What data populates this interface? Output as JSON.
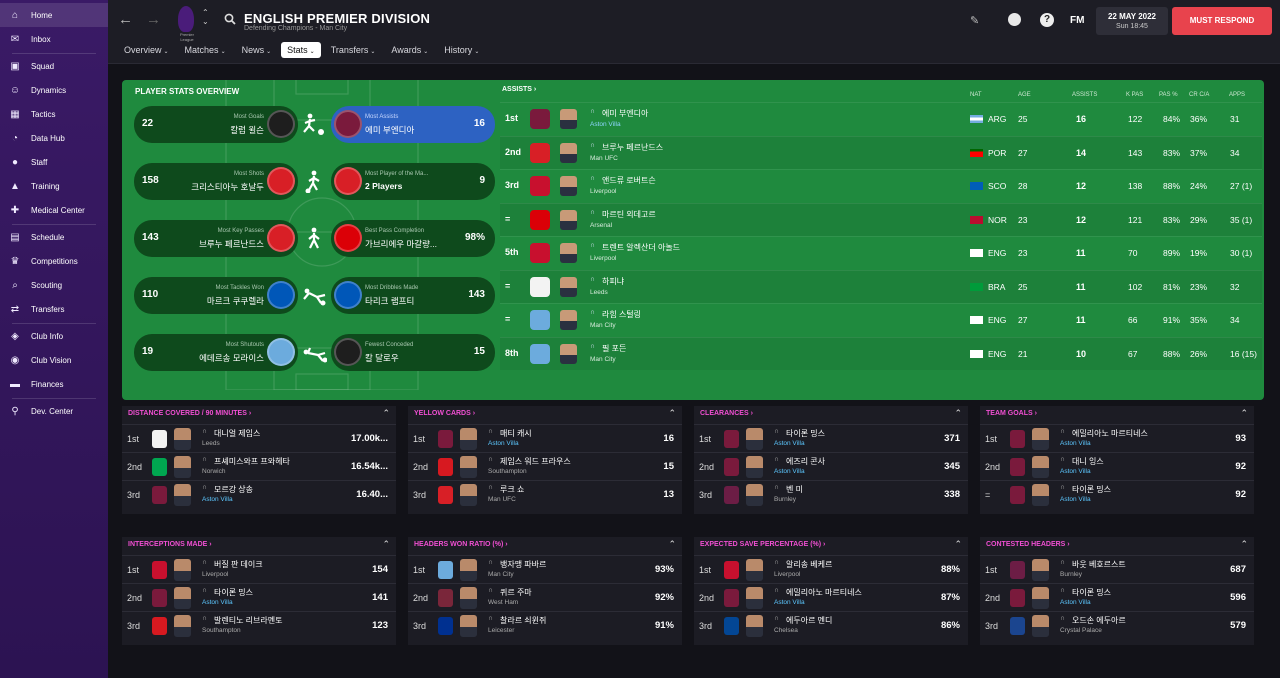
{
  "sidebar": {
    "items": [
      {
        "label": "Home",
        "icon": "home-icon",
        "glyph": "⌂"
      },
      {
        "label": "Inbox",
        "icon": "inbox-icon",
        "glyph": "✉"
      },
      {
        "label": "Squad",
        "icon": "shirt-icon",
        "glyph": "▣"
      },
      {
        "label": "Dynamics",
        "icon": "dynamics-icon",
        "glyph": "☺"
      },
      {
        "label": "Tactics",
        "icon": "tactics-icon",
        "glyph": "▦"
      },
      {
        "label": "Data Hub",
        "icon": "data-hub-icon",
        "glyph": "◔"
      },
      {
        "label": "Staff",
        "icon": "staff-icon",
        "glyph": "●"
      },
      {
        "label": "Training",
        "icon": "training-icon",
        "glyph": "▲"
      },
      {
        "label": "Medical Center",
        "icon": "medical-icon",
        "glyph": "✚"
      },
      {
        "label": "Schedule",
        "icon": "calendar-icon",
        "glyph": "▤"
      },
      {
        "label": "Competitions",
        "icon": "trophy-icon",
        "glyph": "♛"
      },
      {
        "label": "Scouting",
        "icon": "scouting-icon",
        "glyph": "⌕"
      },
      {
        "label": "Transfers",
        "icon": "transfers-icon",
        "glyph": "⇄"
      },
      {
        "label": "Club Info",
        "icon": "shield-icon",
        "glyph": "◈"
      },
      {
        "label": "Club Vision",
        "icon": "vision-icon",
        "glyph": "◉"
      },
      {
        "label": "Finances",
        "icon": "finances-icon",
        "glyph": "▬"
      },
      {
        "label": "Dev. Center",
        "icon": "dev-center-icon",
        "glyph": "⚲"
      }
    ]
  },
  "topbar": {
    "league_mini": "Premier League",
    "title": "ENGLISH PREMIER DIVISION",
    "subtitle": "Defending Champions - Man City",
    "tabs": [
      {
        "label": "Overview",
        "active": false
      },
      {
        "label": "Matches",
        "active": false
      },
      {
        "label": "News",
        "active": false
      },
      {
        "label": "Stats",
        "active": true
      },
      {
        "label": "Transfers",
        "active": false
      },
      {
        "label": "Awards",
        "active": false
      },
      {
        "label": "History",
        "active": false
      }
    ],
    "date": "22 MAY 2022",
    "time": "Sun 18:45",
    "fm_label": "FM",
    "must_respond": "MUST RESPOND",
    "help": "?"
  },
  "overview": {
    "title": "PLAYER STATS OVERVIEW",
    "pairs": [
      {
        "left": {
          "category": "Most Goals",
          "name": "칼럼 윌슨",
          "value": "22",
          "crest": "newcastle"
        },
        "right": {
          "category": "Most Assists",
          "name": "에미 부엔디아",
          "value": "16",
          "crest": "villa",
          "highlight": true
        }
      },
      {
        "left": {
          "category": "Most Shots",
          "name": "크리스티아누 호날두",
          "value": "158",
          "crest": "manutd"
        },
        "right": {
          "category": "Most Player of the Ma...",
          "name": "2 Players",
          "value": "9",
          "crest": "manutd",
          "bold": true
        }
      },
      {
        "left": {
          "category": "Most Key Passes",
          "name": "브루누 페르난드스",
          "value": "143",
          "crest": "manutd"
        },
        "right": {
          "category": "Best Pass Completion",
          "name": "가브리에우 마갈량...",
          "value": "98%",
          "crest": "arsenal"
        }
      },
      {
        "left": {
          "category": "Most Tackles Won",
          "name": "마르크 쿠쿠렐라",
          "value": "110",
          "crest": "brighton"
        },
        "right": {
          "category": "Most Dribbles Made",
          "name": "타리크 램프티",
          "value": "143",
          "crest": "brighton"
        }
      },
      {
        "left": {
          "category": "Most Shutouts",
          "name": "에데르송 모라이스",
          "value": "19",
          "crest": "mancity"
        },
        "right": {
          "category": "Fewest Conceded",
          "name": "칼 달로우",
          "value": "15",
          "crest": "newcastle"
        }
      }
    ]
  },
  "assists": {
    "title": "ASSISTS",
    "columns": {
      "nat": "NAT",
      "age": "AGE",
      "assists": "ASSISTS",
      "kpas": "K PAS",
      "pas": "PAS %",
      "crca": "CR C/A",
      "apps": "APPS"
    },
    "rows": [
      {
        "rank": "1st",
        "name": "에미 부엔디아",
        "club": "Aston Villa",
        "club_hl": true,
        "crest": "villa",
        "flag": "arg",
        "nat": "ARG",
        "age": "25",
        "assists": "16",
        "kpas": "122",
        "pas": "84%",
        "crca": "36%",
        "apps": "31"
      },
      {
        "rank": "2nd",
        "name": "브루누 페르난드스",
        "club": "Man UFC",
        "club_hl": false,
        "crest": "manutd",
        "flag": "por",
        "nat": "POR",
        "age": "27",
        "assists": "14",
        "kpas": "143",
        "pas": "83%",
        "crca": "37%",
        "apps": "34"
      },
      {
        "rank": "3rd",
        "name": "앤드류 로버트슨",
        "club": "Liverpool",
        "club_hl": false,
        "crest": "liverpool",
        "flag": "sco",
        "nat": "SCO",
        "age": "28",
        "assists": "12",
        "kpas": "138",
        "pas": "88%",
        "crca": "24%",
        "apps": "27 (1)"
      },
      {
        "rank": "=",
        "name": "마르틴 외데고르",
        "club": "Arsenal",
        "club_hl": false,
        "crest": "arsenal",
        "flag": "nor",
        "nat": "NOR",
        "age": "23",
        "assists": "12",
        "kpas": "121",
        "pas": "83%",
        "crca": "29%",
        "apps": "35 (1)"
      },
      {
        "rank": "5th",
        "name": "트렌트 알렉산더 아놀드",
        "club": "Liverpool",
        "club_hl": false,
        "crest": "liverpool",
        "flag": "eng",
        "nat": "ENG",
        "age": "23",
        "assists": "11",
        "kpas": "70",
        "pas": "89%",
        "crca": "19%",
        "apps": "30 (1)"
      },
      {
        "rank": "=",
        "name": "하피냐",
        "club": "Leeds",
        "club_hl": false,
        "crest": "leeds",
        "flag": "bra",
        "nat": "BRA",
        "age": "25",
        "assists": "11",
        "kpas": "102",
        "pas": "81%",
        "crca": "23%",
        "apps": "32"
      },
      {
        "rank": "=",
        "name": "라힘 스털링",
        "club": "Man City",
        "club_hl": false,
        "crest": "mancity",
        "flag": "eng",
        "nat": "ENG",
        "age": "27",
        "assists": "11",
        "kpas": "66",
        "pas": "91%",
        "crca": "35%",
        "apps": "34"
      },
      {
        "rank": "8th",
        "name": "필 포든",
        "club": "Man City",
        "club_hl": false,
        "crest": "mancity",
        "flag": "eng",
        "nat": "ENG",
        "age": "21",
        "assists": "10",
        "kpas": "67",
        "pas": "88%",
        "crca": "26%",
        "apps": "16 (15)"
      }
    ]
  },
  "cards": [
    {
      "title": "DISTANCE COVERED / 90 MINUTES",
      "rows": [
        {
          "rank": "1st",
          "name": "대니얼 제임스",
          "club": "Leeds",
          "club_hl": false,
          "crest": "leeds",
          "value": "17.00k..."
        },
        {
          "rank": "2nd",
          "name": "프셰미스와프 프와헤타",
          "club": "Norwich",
          "club_hl": false,
          "crest": "norwich",
          "value": "16.54k..."
        },
        {
          "rank": "3rd",
          "name": "모르강 상송",
          "club": "Aston Villa",
          "club_hl": true,
          "crest": "villa",
          "value": "16.40..."
        }
      ]
    },
    {
      "title": "YELLOW CARDS",
      "rows": [
        {
          "rank": "1st",
          "name": "매티 캐시",
          "club": "Aston Villa",
          "club_hl": true,
          "crest": "villa",
          "value": "16"
        },
        {
          "rank": "2nd",
          "name": "제임스 워드 프라우스",
          "club": "Southampton",
          "club_hl": false,
          "crest": "southampton",
          "value": "15"
        },
        {
          "rank": "3rd",
          "name": "루크 쇼",
          "club": "Man UFC",
          "club_hl": false,
          "crest": "manutd",
          "value": "13"
        }
      ]
    },
    {
      "title": "CLEARANCES",
      "rows": [
        {
          "rank": "1st",
          "name": "타이론 밍스",
          "club": "Aston Villa",
          "club_hl": true,
          "crest": "villa",
          "value": "371"
        },
        {
          "rank": "2nd",
          "name": "에즈리 콘사",
          "club": "Aston Villa",
          "club_hl": true,
          "crest": "villa",
          "value": "345"
        },
        {
          "rank": "3rd",
          "name": "벤 미",
          "club": "Burnley",
          "club_hl": false,
          "crest": "burnley",
          "value": "338"
        }
      ]
    },
    {
      "title": "TEAM GOALS",
      "rows": [
        {
          "rank": "1st",
          "name": "에밀리아노 마르티네스",
          "club": "Aston Villa",
          "club_hl": true,
          "crest": "villa",
          "value": "93"
        },
        {
          "rank": "2nd",
          "name": "대니 잉스",
          "club": "Aston Villa",
          "club_hl": true,
          "crest": "villa",
          "value": "92"
        },
        {
          "rank": "=",
          "name": "타이론 밍스",
          "club": "Aston Villa",
          "club_hl": true,
          "crest": "villa",
          "value": "92"
        }
      ]
    },
    {
      "title": "INTERCEPTIONS MADE",
      "rows": [
        {
          "rank": "1st",
          "name": "버질 판 데이크",
          "club": "Liverpool",
          "club_hl": false,
          "crest": "liverpool",
          "value": "154"
        },
        {
          "rank": "2nd",
          "name": "타이론 밍스",
          "club": "Aston Villa",
          "club_hl": true,
          "crest": "villa",
          "value": "141"
        },
        {
          "rank": "3rd",
          "name": "발렌티노 리브라멘토",
          "club": "Southampton",
          "club_hl": false,
          "crest": "southampton",
          "value": "123"
        }
      ]
    },
    {
      "title": "HEADERS WON RATIO (%)",
      "rows": [
        {
          "rank": "1st",
          "name": "뱅자맹 파바르",
          "club": "Man City",
          "club_hl": false,
          "crest": "mancity",
          "value": "93%"
        },
        {
          "rank": "2nd",
          "name": "퀴르 주마",
          "club": "West Ham",
          "club_hl": false,
          "crest": "westham",
          "value": "92%"
        },
        {
          "rank": "3rd",
          "name": "찰라르 쇠윈쥐",
          "club": "Leicester",
          "club_hl": false,
          "crest": "leicester",
          "value": "91%"
        }
      ]
    },
    {
      "title": "EXPECTED SAVE PERCENTAGE (%)",
      "rows": [
        {
          "rank": "1st",
          "name": "알리송 베케르",
          "club": "Liverpool",
          "club_hl": false,
          "crest": "liverpool",
          "value": "88%"
        },
        {
          "rank": "2nd",
          "name": "에밀리아노 마르티네스",
          "club": "Aston Villa",
          "club_hl": true,
          "crest": "villa",
          "value": "87%"
        },
        {
          "rank": "3rd",
          "name": "에두아르 멘디",
          "club": "Chelsea",
          "club_hl": false,
          "crest": "chelsea",
          "value": "86%"
        }
      ]
    },
    {
      "title": "CONTESTED HEADERS",
      "rows": [
        {
          "rank": "1st",
          "name": "바웃 베호르스트",
          "club": "Burnley",
          "club_hl": false,
          "crest": "burnley",
          "value": "687"
        },
        {
          "rank": "2nd",
          "name": "타이론 밍스",
          "club": "Aston Villa",
          "club_hl": true,
          "crest": "villa",
          "value": "596"
        },
        {
          "rank": "3rd",
          "name": "오드손 에두아르",
          "club": "Crystal Palace",
          "club_hl": false,
          "crest": "palace",
          "value": "579"
        }
      ]
    }
  ],
  "colors": {
    "villa": "#7a1a3c",
    "manutd": "#d81f26",
    "liverpool": "#c8102e",
    "arsenal": "#db0007",
    "leeds": "#f3f3f3",
    "mancity": "#6cabdd",
    "newcastle": "#1e1e1e",
    "brighton": "#0057b8",
    "norwich": "#00a650",
    "southampton": "#d71920",
    "burnley": "#6c1d45",
    "westham": "#7a263a",
    "leicester": "#003090",
    "chelsea": "#034694",
    "palace": "#1b458f",
    "accent_magenta": "#f04fd2",
    "must_respond": "#e8434d",
    "pitch_green": "#1f8a3e",
    "highlight_blue": "#2d62c2"
  },
  "flags": {
    "arg": [
      "#74acdf",
      "#ffffff",
      "#74acdf"
    ],
    "por": [
      "#006600",
      "#ff0000",
      "#ff0000"
    ],
    "sco": [
      "#005eb8",
      "#005eb8",
      "#005eb8"
    ],
    "nor": [
      "#ba0c2f",
      "#ba0c2f",
      "#ba0c2f"
    ],
    "eng": [
      "#ffffff",
      "#ffffff",
      "#ffffff"
    ],
    "bra": [
      "#009b3a",
      "#009b3a",
      "#009b3a"
    ]
  }
}
